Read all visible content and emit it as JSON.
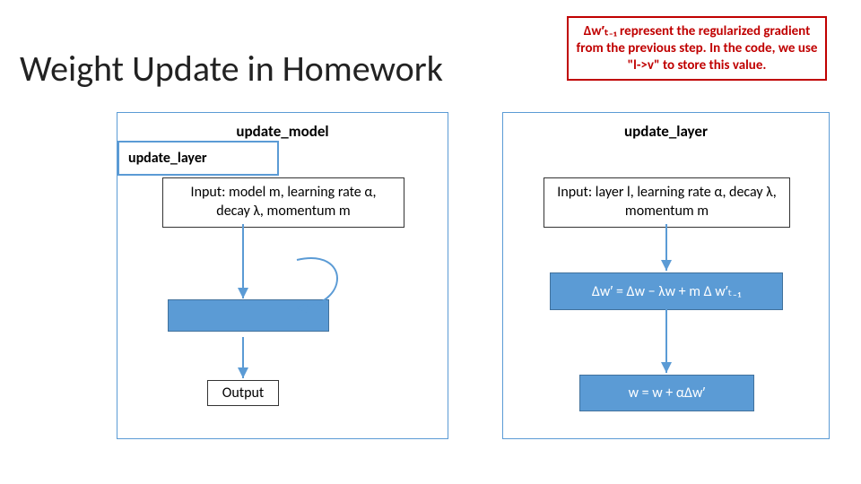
{
  "title": "Weight Update in Homework",
  "annotation": "Δw′ₜ₋₁ represent the regularized gradient from the previous step. In the code, we use \"l->v\" to store this value.",
  "left_panel": {
    "title": "update_model",
    "input": "Input: model m, learning rate α, decay λ, momentum m",
    "layer_box": "update_layer",
    "output": "Output"
  },
  "right_panel": {
    "title": "update_layer",
    "input": "Input: layer l, learning rate α, decay λ, momentum m",
    "eq1": "Δw′ = Δw − λw + m Δ w′ₜ₋₁",
    "eq2": "w = w + αΔw′"
  }
}
